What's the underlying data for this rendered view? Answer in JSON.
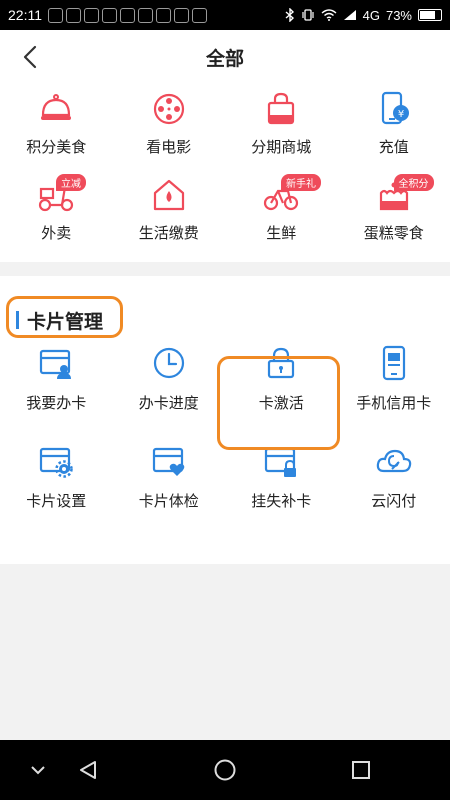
{
  "status_bar": {
    "time": "22:11",
    "network": "4G",
    "battery": "73%",
    "battery_level": 0.73
  },
  "header": {
    "title": "全部"
  },
  "top_grid": [
    {
      "label": "积分美食",
      "icon": "food-cloche-icon",
      "tag": ""
    },
    {
      "label": "看电影",
      "icon": "film-reel-icon",
      "tag": ""
    },
    {
      "label": "分期商城",
      "icon": "shopping-bag-icon",
      "tag": ""
    },
    {
      "label": "充值",
      "icon": "phone-topup-icon",
      "tag": ""
    },
    {
      "label": "外卖",
      "icon": "scooter-icon",
      "tag": "立减"
    },
    {
      "label": "生活缴费",
      "icon": "house-drop-icon",
      "tag": ""
    },
    {
      "label": "生鲜",
      "icon": "bicycle-icon",
      "tag": "新手礼"
    },
    {
      "label": "蛋糕零食",
      "icon": "cake-icon",
      "tag": "全积分"
    }
  ],
  "card_section": {
    "title": "卡片管理",
    "items": [
      {
        "label": "我要办卡",
        "icon": "card-user-icon"
      },
      {
        "label": "办卡进度",
        "icon": "clock-icon"
      },
      {
        "label": "卡激活",
        "icon": "lock-icon"
      },
      {
        "label": "手机信用卡",
        "icon": "mobile-card-icon"
      },
      {
        "label": "卡片设置",
        "icon": "card-gear-icon"
      },
      {
        "label": "卡片体检",
        "icon": "card-heart-icon"
      },
      {
        "label": "挂失补卡",
        "icon": "card-lock-icon"
      },
      {
        "label": "云闪付",
        "icon": "cloud-pay-icon"
      }
    ]
  },
  "colors": {
    "red_icon": "#ef4b5a",
    "blue_icon": "#2e86de",
    "highlight": "#f08a24"
  }
}
